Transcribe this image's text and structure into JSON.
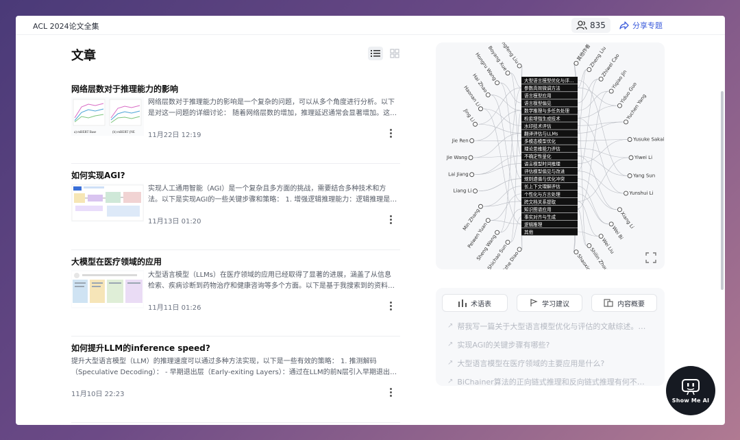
{
  "app": {
    "title": "ACL 2024论文全集",
    "follower_count": "835",
    "share_label": "分享专题"
  },
  "section": {
    "title": "文章"
  },
  "articles": [
    {
      "title": "网络层数对于推理能力的影响",
      "summary": "网络层数对于推理能力的影响是一个复杂的问题，可以从多个角度进行分析。以下是对这一问题的详细讨论： 随着网络层数的增加，推理延迟通常会显著增加。这…",
      "date": "11月22日 12:19",
      "thumb_captions": [
        "a) mBERT Base",
        "(b) mBERT (NE"
      ]
    },
    {
      "title": "如何实现AGI?",
      "summary": "实现人工通用智能（AGI）是一个复杂且多方面的挑战，需要结合多种技术和方法。以下是实现AGI的一些关键步骤和策略： 1. 增强逻辑推理能力：逻辑推理是实现A…",
      "date": "11月13日 01:20"
    },
    {
      "title": "大模型在医疗领域的应用",
      "summary": "大型语言模型（LLMs）在医疗领域的应用已经取得了显著的进展，涵盖了从信息检索、疾病诊断到药物治疗和健康咨询等多个方面。以下是基于我搜索到的资料对…",
      "date": "11月11日 01:26"
    },
    {
      "title": "如何提升LLM的inference speed?",
      "summary": "提升大型语言模型（LLM）的推理速度可以通过多种方法实现，以下是一些有效的策略： 1. 推测解码（Speculative Decoding）： - 早期退出层（Early-exiting Layers）：通过在LLM的前N层引入早期退出层，…",
      "date": "11月10日 22:23"
    }
  ],
  "graph": {
    "topics": [
      "大型语言模型优化与评…",
      "参数高效微调方法",
      "语言模型应用",
      "语言模型偏见",
      "数学推理与多任务处理",
      "检索增强生成技术",
      "水印技术评估",
      "翻译评估与LLMs",
      "多模态模型优化",
      "理论思维能力评估",
      "不确定性量化",
      "语言模型时间推理",
      "评估模型偏见与改进",
      "规则遵循与优化冲突",
      "长上下文理解评估",
      "个性化与方言处理",
      "跨文档关系提取",
      "知识图谱应用",
      "事实对齐与生成",
      "逻辑推理",
      "其他"
    ],
    "left_authors": [
      "Boyang Xue",
      "Hongru Wang",
      "Hai Zhao",
      "Haonan Li",
      "Jing Li",
      "Jie Ren",
      "Jie Wang",
      "Lai Jiang",
      "Liang Li",
      "Min Zhang",
      "Peiwen Yuan",
      "Sheng Wang",
      "Shichao Sun",
      "Shizhe Diao"
    ],
    "left_top_author": "Hangfeng Liu",
    "right_authors": [
      "其他作者",
      "Zheng Liu",
      "Zhiwei Cao",
      "Yiqiao Jin",
      "Yiduo Guo",
      "Yuchen Yang",
      "Yusuke Sakai",
      "Yiwei Li",
      "Yang Sun",
      "Yunshui Li",
      "Xiang Li",
      "Wei Bi",
      "Wei Liu",
      "Shilin Zhou",
      "Shaoxiong Feng"
    ]
  },
  "qa": {
    "tabs": [
      "术语表",
      "学习建议",
      "内容概要"
    ],
    "questions": [
      "帮我写一篇关于大型语言模型优化与评估的文献综述。…",
      "实现AGI的关键步骤有哪些?",
      "大型语言模型在医疗领域的主要应用是什么?",
      "BiChainer算法的正向链式推理和反向链式推理有何不…"
    ]
  },
  "badge": {
    "label": "Show Me AI"
  }
}
